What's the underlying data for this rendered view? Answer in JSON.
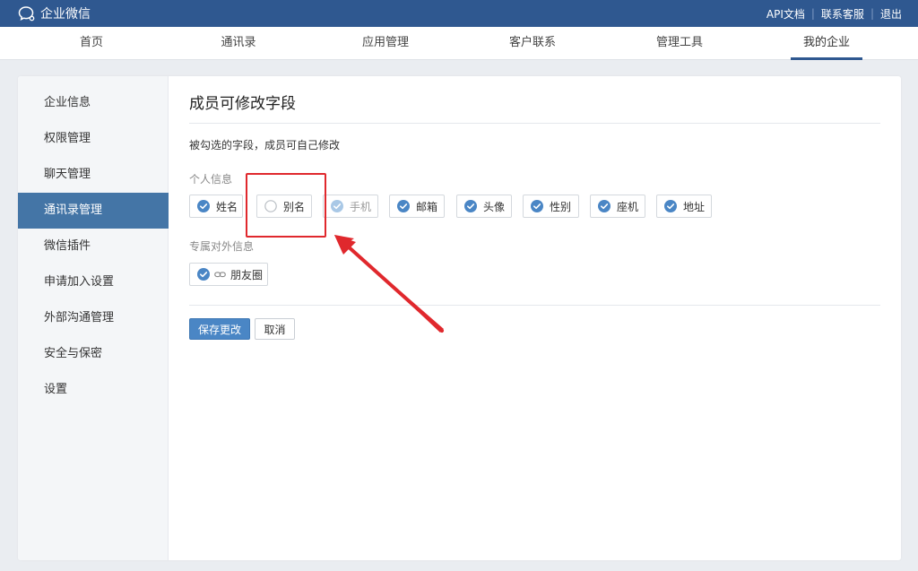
{
  "app": {
    "title": "企业微信"
  },
  "topbar": {
    "links": [
      "API文档",
      "联系客服",
      "退出"
    ]
  },
  "nav": {
    "items": [
      "首页",
      "通讯录",
      "应用管理",
      "客户联系",
      "管理工具",
      "我的企业"
    ],
    "active": "我的企业"
  },
  "sidebar": {
    "items": [
      "企业信息",
      "权限管理",
      "聊天管理",
      "通讯录管理",
      "微信插件",
      "申请加入设置",
      "外部沟通管理",
      "安全与保密",
      "设置"
    ],
    "active": "通讯录管理"
  },
  "main": {
    "title": "成员可修改字段",
    "description": "被勾选的字段，成员可自己修改",
    "personal_section": {
      "title": "个人信息",
      "fields": [
        {
          "label": "姓名",
          "checked": true,
          "disabled": false
        },
        {
          "label": "别名",
          "checked": false,
          "disabled": false
        },
        {
          "label": "手机",
          "checked": true,
          "disabled": true
        },
        {
          "label": "邮箱",
          "checked": true,
          "disabled": false
        },
        {
          "label": "头像",
          "checked": true,
          "disabled": false
        },
        {
          "label": "性别",
          "checked": true,
          "disabled": false
        },
        {
          "label": "座机",
          "checked": true,
          "disabled": false
        },
        {
          "label": "地址",
          "checked": true,
          "disabled": false
        }
      ]
    },
    "external_section": {
      "title": "专属对外信息",
      "fields": [
        {
          "label": "朋友圈",
          "checked": true,
          "icon": "link-icon"
        }
      ]
    },
    "save_label": "保存更改",
    "cancel_label": "取消"
  },
  "colors": {
    "brand": "#2f5890",
    "accent": "#4a86c5",
    "sidebar_active": "#4475a6",
    "annotation": "#e0282d"
  }
}
